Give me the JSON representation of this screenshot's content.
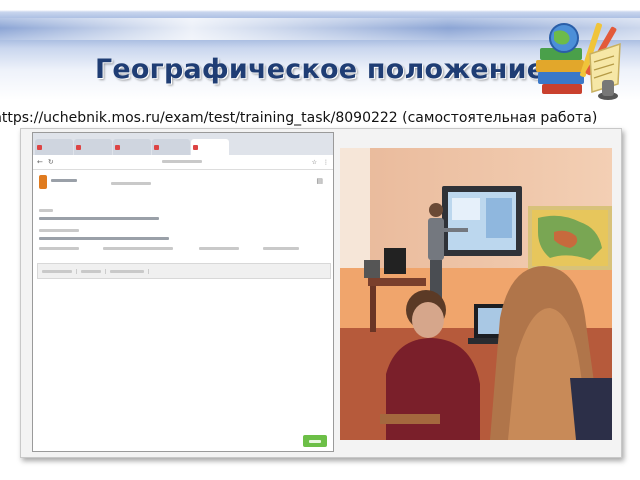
{
  "slide": {
    "title": "Географическое положение",
    "url": "https://uchebnik.mos.ru/exam/test/training_task/8090222 (самостоятельная работа)"
  },
  "icons": {
    "clipart": "school-supplies-clipart",
    "logo": "site-logo-icon",
    "back": "back-arrow-icon",
    "reload": "reload-icon",
    "menu": "menu-icon"
  },
  "colors": {
    "title": "#1f3d74",
    "band": "#7f9bd0",
    "logo": "#e07b1f",
    "answer_button": "#6cbf47"
  },
  "photo": {
    "description_icon": "classroom-photo"
  }
}
